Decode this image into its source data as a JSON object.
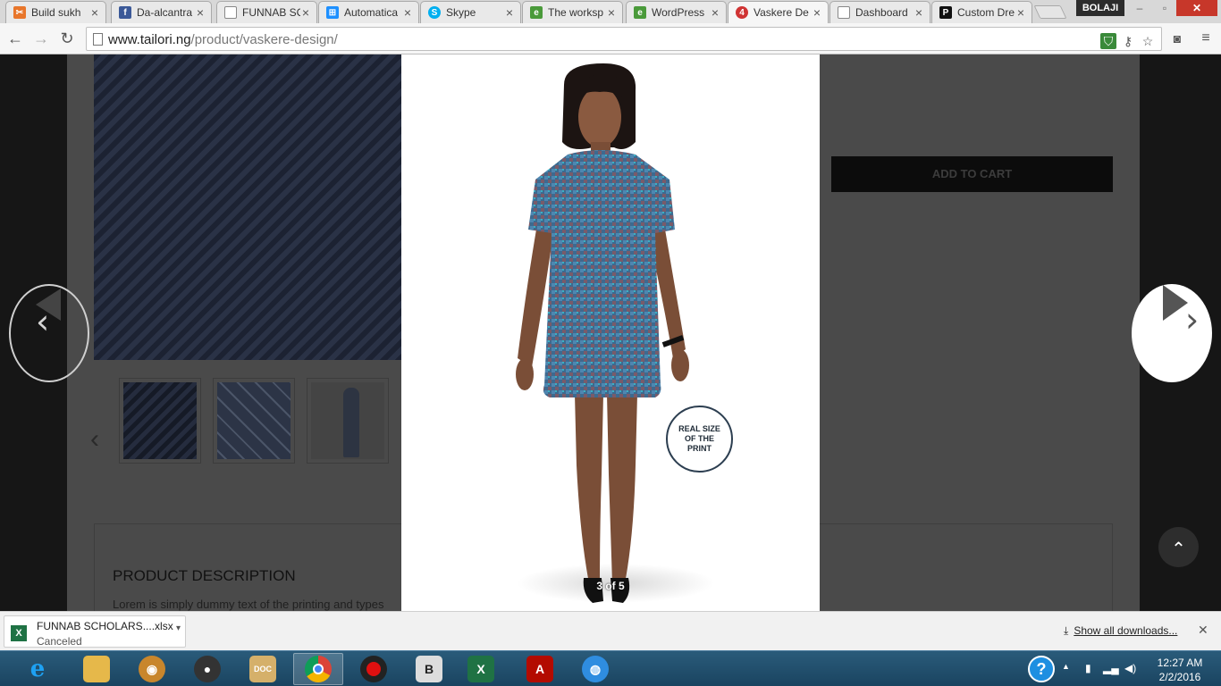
{
  "browser": {
    "tabs": [
      {
        "title": "Build sukh",
        "icon": "scissors-favicon",
        "color": "#e8762b"
      },
      {
        "title": "Da-alcantra",
        "icon": "facebook-favicon",
        "color": "#3b5998"
      },
      {
        "title": "FUNNAB SC",
        "icon": "document-favicon",
        "color": "#888888"
      },
      {
        "title": "Automatica",
        "icon": "windows-favicon",
        "color": "#1e90ff"
      },
      {
        "title": "Skype",
        "icon": "skype-favicon",
        "color": "#00aff0"
      },
      {
        "title": "The worksp",
        "icon": "evernote-favicon",
        "color": "#4a9a3a"
      },
      {
        "title": "WordPress",
        "icon": "evernote-favicon",
        "color": "#4a9a3a"
      },
      {
        "title": "Vaskere De",
        "icon": "tailori-favicon",
        "color": "#d03434",
        "badge": "4"
      },
      {
        "title": "Dashboard",
        "icon": "document-favicon",
        "color": "#888888"
      },
      {
        "title": "Custom Dre",
        "icon": "p-favicon",
        "color": "#111111"
      }
    ],
    "user": "BOLAJI",
    "url_host": "www.tailori.ng",
    "url_path": "/product/vaskere-design/"
  },
  "page": {
    "add_to_cart": "ADD TO CART",
    "description_title": "PRODUCT DESCRIPTION",
    "description_text": "Lorem is simply dummy text of the printing and types"
  },
  "lightbox": {
    "counter": "3 of 5",
    "badge_text": "REAL SIZE OF THE PRINT",
    "current_index": 3,
    "total": 5
  },
  "downloads": {
    "file_name": "FUNNAB SCHOLARS....xlsx",
    "status": "Canceled",
    "show_all": "Show all downloads..."
  },
  "taskbar": {
    "apps": [
      "internet-explorer",
      "file-explorer",
      "app-orange",
      "speaker-app",
      "document-app",
      "chrome",
      "record-app",
      "vpn-app",
      "excel",
      "acrobat",
      "network-app"
    ],
    "time": "12:27 AM",
    "date": "2/2/2016"
  },
  "colors": {
    "overlay": "#161616",
    "close_red": "#c7372a",
    "taskbar": "#1a4460"
  }
}
